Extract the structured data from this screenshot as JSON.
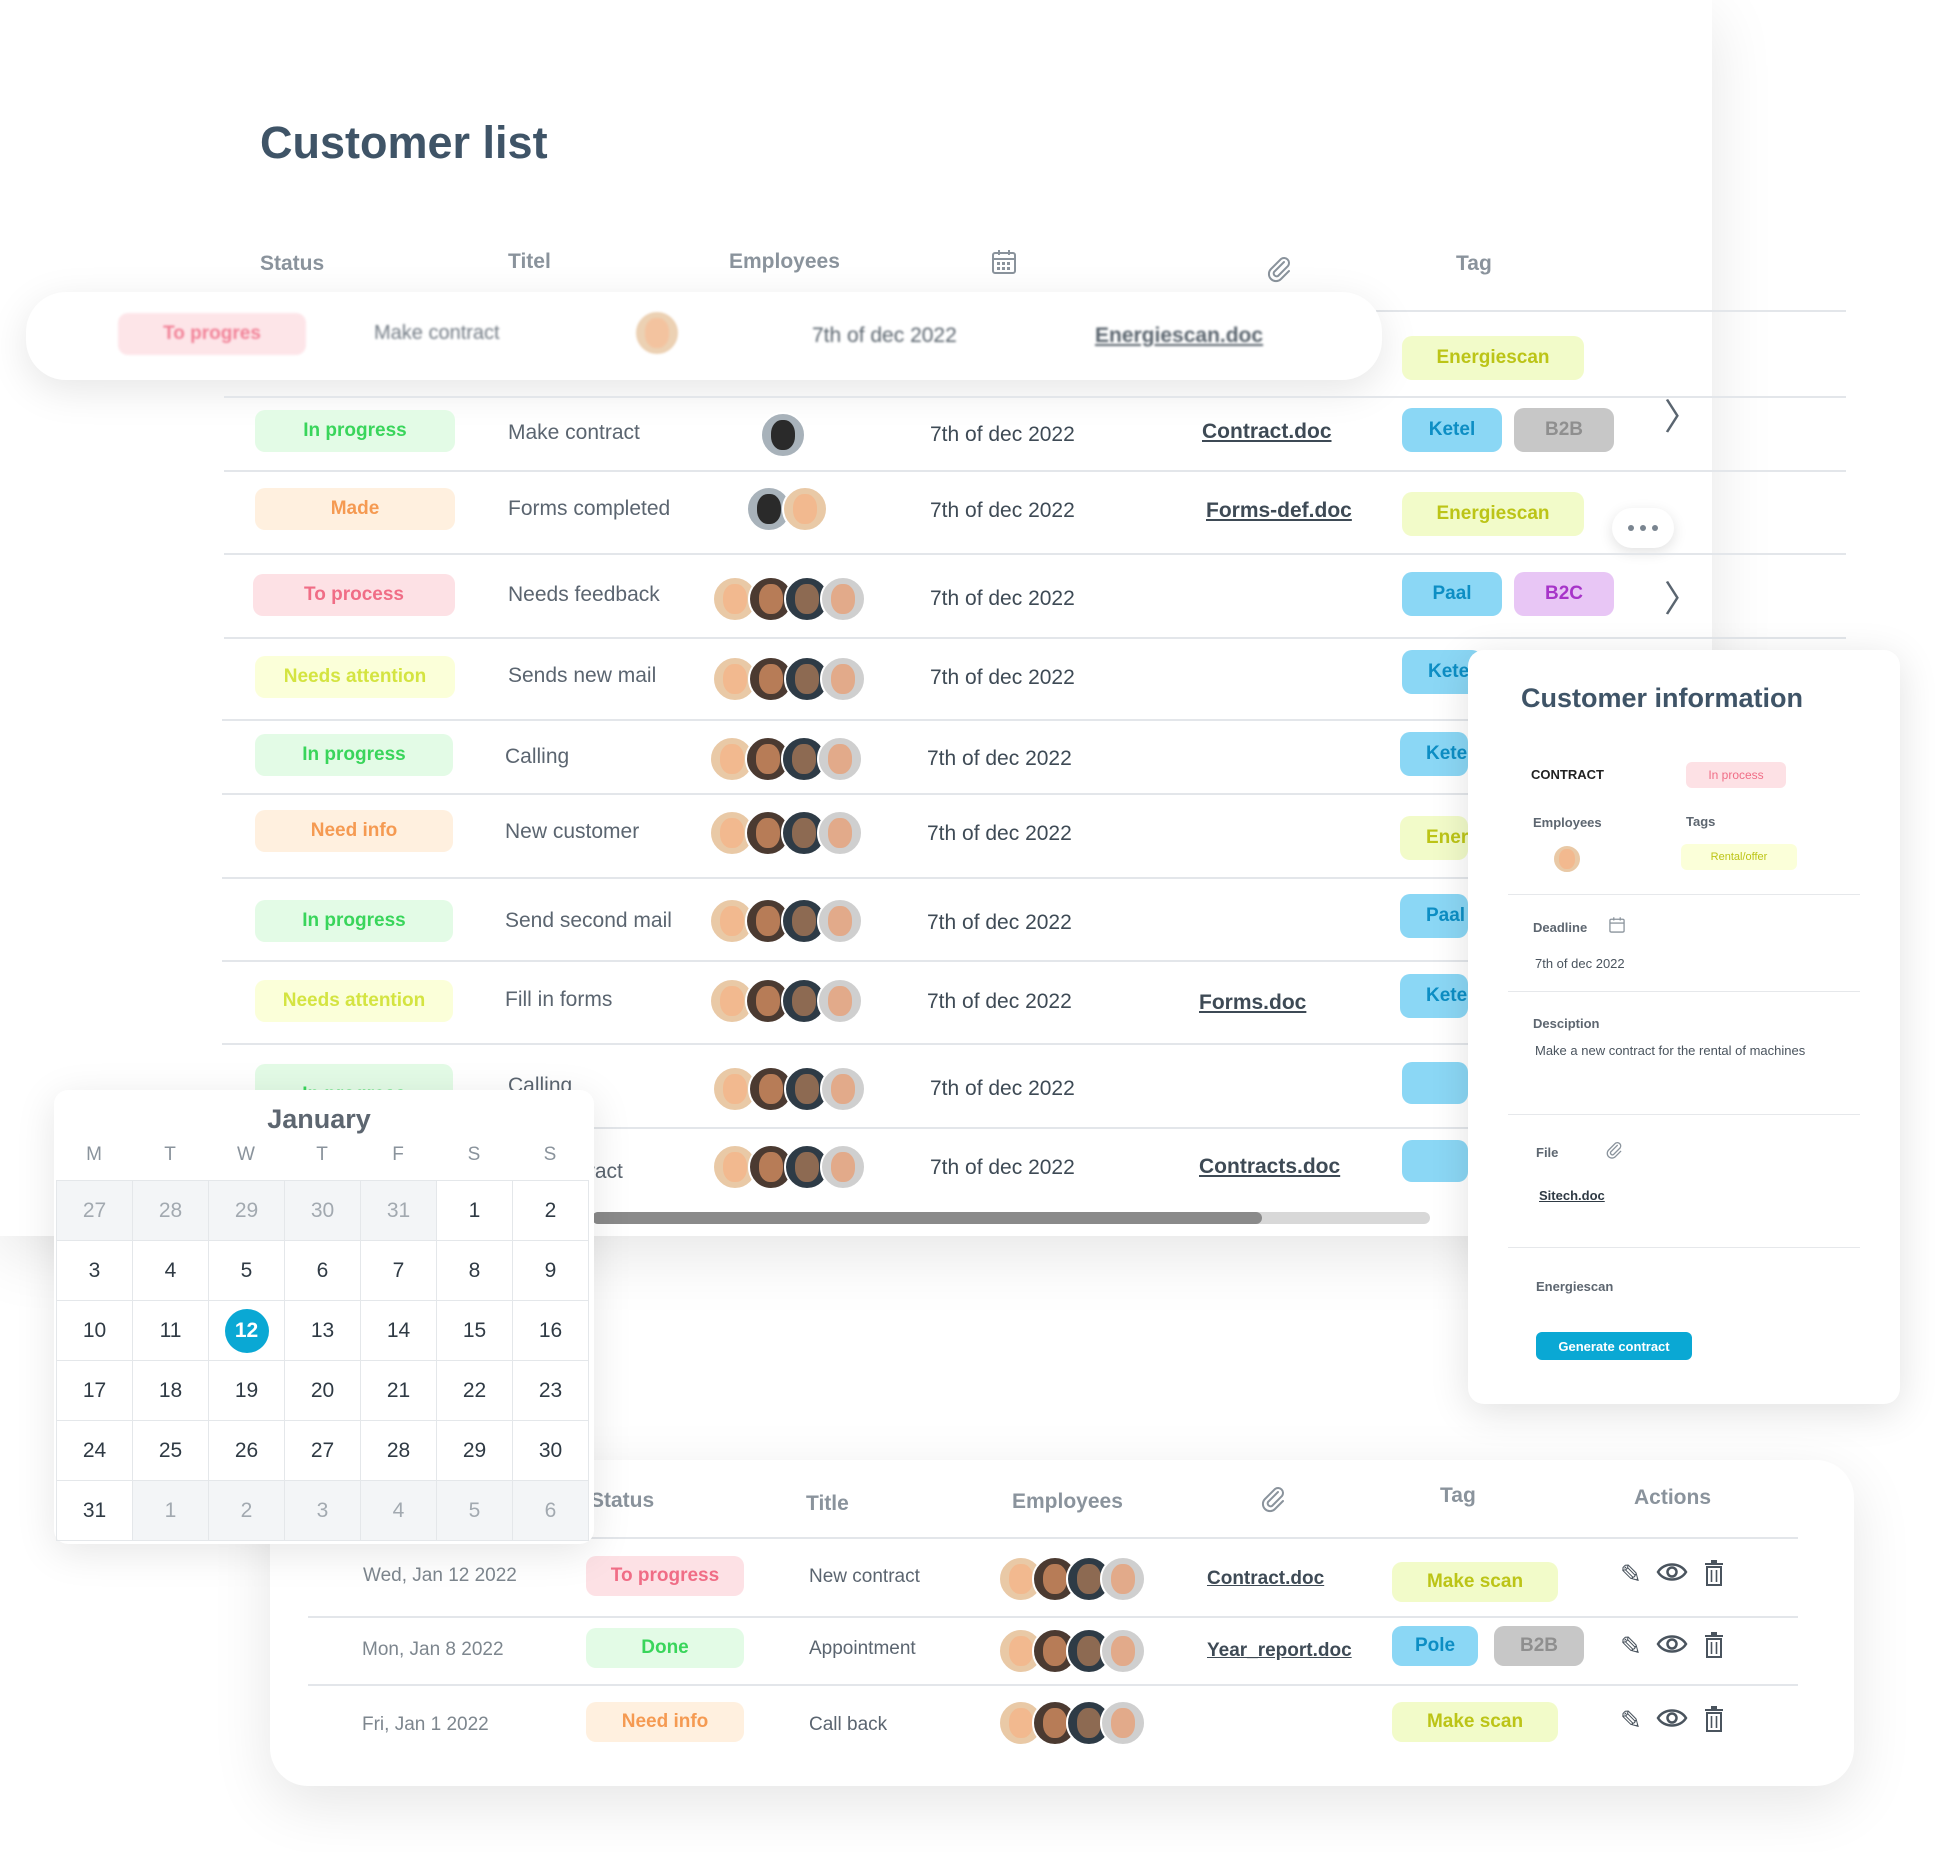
{
  "title": "Customer list",
  "columns": {
    "status": "Status",
    "title": "Titel",
    "employees": "Employees",
    "tag": "Tag"
  },
  "float_row": {
    "status": "To progres",
    "title": "Make contract",
    "date": "7th of dec 2022",
    "file": "Energiescan.doc",
    "tag": "Energiescan"
  },
  "rows": [
    {
      "status": "In progress",
      "title": "Make contract",
      "date": "7th of dec 2022",
      "file": "Contract.doc",
      "tags": [
        "Ketel",
        "B2B"
      ]
    },
    {
      "status": "Made",
      "title": "Forms completed",
      "date": "7th of dec 2022",
      "file": "Forms-def.doc",
      "tags": [
        "Energiescan"
      ]
    },
    {
      "status": "To process",
      "title": "Needs feedback",
      "date": "7th of dec 2022",
      "file": "",
      "tags": [
        "Paal",
        "B2C"
      ]
    },
    {
      "status": "Needs attention",
      "title": "Sends new mail",
      "date": "7th of dec 2022",
      "file": "",
      "tags": [
        "Kete"
      ]
    },
    {
      "status": "In progress",
      "title": "Calling",
      "date": "7th of dec 2022",
      "file": "",
      "tags": [
        "Kete"
      ]
    },
    {
      "status": "Need info",
      "title": "New customer",
      "date": "7th of dec 2022",
      "file": "",
      "tags": [
        "Ener"
      ]
    },
    {
      "status": "In progress",
      "title": "Send second mail",
      "date": "7th of dec 2022",
      "file": "",
      "tags": [
        "Paal"
      ]
    },
    {
      "status": "Needs attention",
      "title": "Fill in forms",
      "date": "7th of dec 2022",
      "file": "Forms.doc",
      "tags": [
        "Kete"
      ]
    },
    {
      "status": "In progress",
      "title": "Calling",
      "date": "7th of dec 2022",
      "file": "",
      "tags": [
        ""
      ]
    },
    {
      "status": "",
      "title": "tract",
      "date": "7th of dec 2022",
      "file": "Contracts.doc",
      "tags": [
        ""
      ]
    }
  ],
  "scroll_progress": 0.8,
  "info": {
    "title": "Customer information",
    "contract_label": "CONTRACT",
    "contract_status": "In process",
    "employees_label": "Employees",
    "tags_label": "Tags",
    "tag": "Rental/offer",
    "deadline_label": "Deadline",
    "deadline": "7th of dec 2022",
    "description_label": "Desciption",
    "description": "Make a new contract for the rental of machines",
    "file_label": "File",
    "file": "Sitech.doc",
    "category": "Energiescan",
    "button": "Generate contract"
  },
  "calendar": {
    "month": "January",
    "dow": [
      "M",
      "T",
      "W",
      "T",
      "F",
      "S",
      "S"
    ],
    "days": [
      "27",
      "28",
      "29",
      "30",
      "31",
      "1",
      "2",
      "3",
      "4",
      "5",
      "6",
      "7",
      "8",
      "9",
      "10",
      "11",
      "12",
      "13",
      "14",
      "15",
      "16",
      "17",
      "18",
      "19",
      "20",
      "21",
      "22",
      "23",
      "24",
      "25",
      "26",
      "27",
      "28",
      "29",
      "30",
      "31",
      "1",
      "2",
      "3",
      "4",
      "5",
      "6"
    ],
    "muted_indices": [
      0,
      1,
      2,
      3,
      4,
      36,
      37,
      38,
      39,
      40,
      41
    ],
    "selected_index": 16
  },
  "bottom": {
    "columns": {
      "status": "Status",
      "title": "Title",
      "employees": "Employees",
      "tag": "Tag",
      "actions": "Actions"
    },
    "rows": [
      {
        "date": "Wed, Jan 12 2022",
        "status": "To progress",
        "title": "New contract",
        "file": "Contract.doc",
        "tags": [
          "Make scan"
        ]
      },
      {
        "date": "Mon, Jan 8 2022",
        "status": "Done",
        "title": "Appointment",
        "file": "Year_report.doc",
        "tags": [
          "Pole",
          "B2B"
        ]
      },
      {
        "date": "Fri, Jan 1 2022",
        "status": "Need info",
        "title": "Call back",
        "file": "",
        "tags": [
          "Make scan"
        ]
      }
    ]
  },
  "icons": {
    "calendar": "calendar-icon",
    "attachment": "paperclip-icon",
    "more": "more-icon",
    "edit": "pencil-icon",
    "view": "eye-icon",
    "delete": "trash-icon"
  },
  "colors": {
    "accent": "#0aa8d4",
    "title": "#3f5467"
  }
}
